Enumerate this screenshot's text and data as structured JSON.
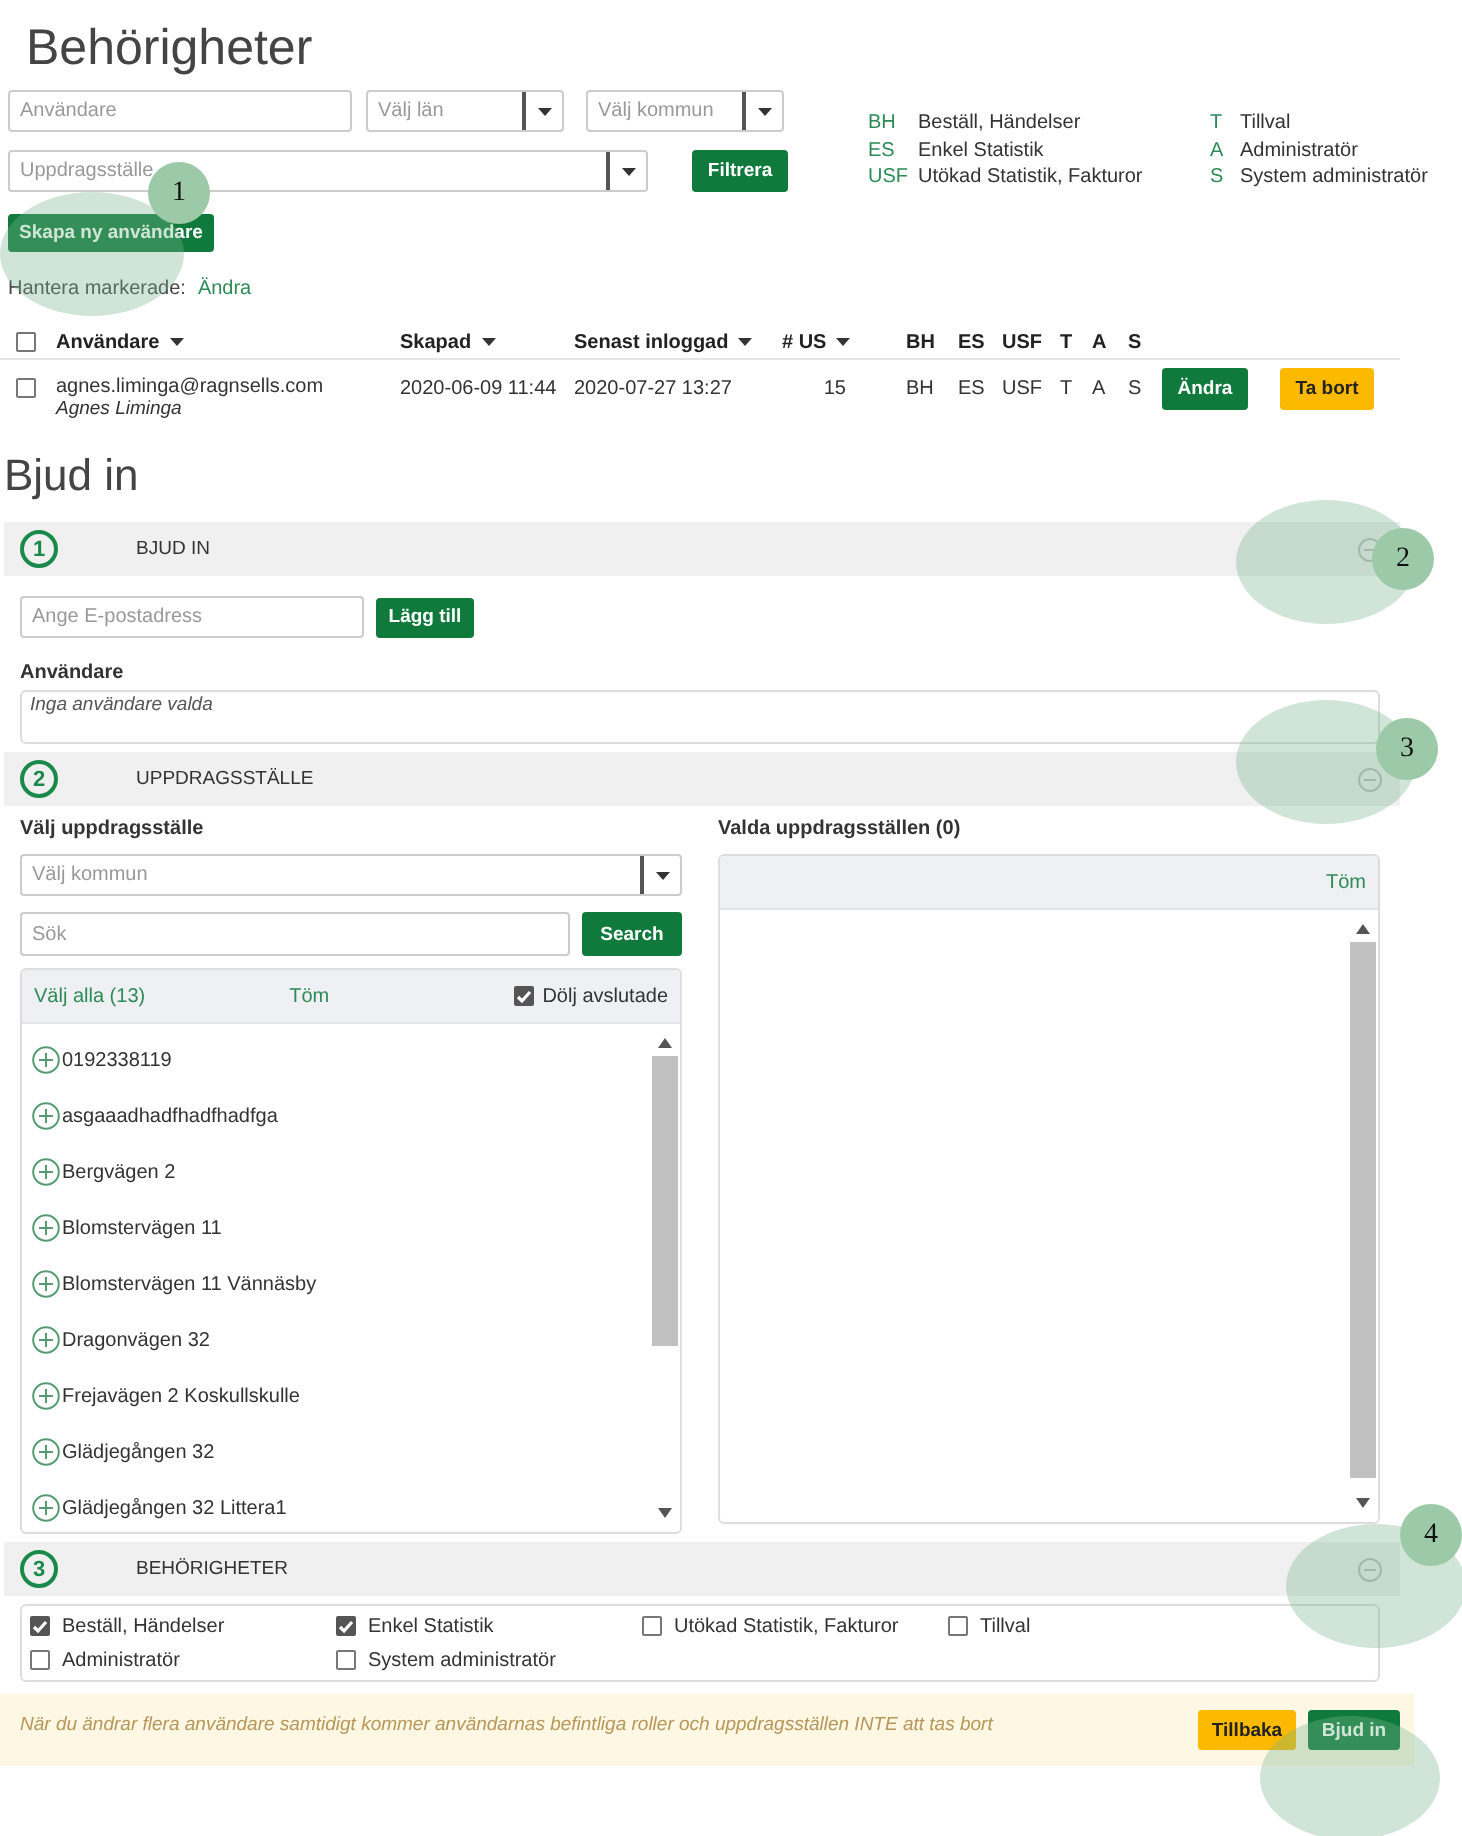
{
  "page_title": "Behörigheter",
  "filters": {
    "user": {
      "placeholder": "Användare"
    },
    "county": {
      "placeholder": "Välj län"
    },
    "municipality": {
      "placeholder": "Välj kommun"
    },
    "assignment": {
      "placeholder": "Uppdragsställe"
    },
    "filter_button": "Filtrera"
  },
  "legend": [
    {
      "code": "BH",
      "label": "Beställ, Händelser"
    },
    {
      "code": "T",
      "label": "Tillval"
    },
    {
      "code": "ES",
      "label": "Enkel Statistik"
    },
    {
      "code": "A",
      "label": "Administratör"
    },
    {
      "code": "USF",
      "label": "Utökad Statistik, Fakturor"
    },
    {
      "code": "S",
      "label": "System administratör"
    }
  ],
  "create_button": "Skapa ny användare",
  "bulk": {
    "label": "Hantera markerade:",
    "link": "Ändra"
  },
  "table": {
    "select_all_checked": false,
    "columns": [
      {
        "label": "Användare",
        "sortable": true
      },
      {
        "label": "Skapad",
        "sortable": true
      },
      {
        "label": "Senast inloggad",
        "sortable": true
      },
      {
        "label": "# US",
        "sortable": true
      },
      {
        "label": "BH",
        "sortable": false
      },
      {
        "label": "ES",
        "sortable": false
      },
      {
        "label": "USF",
        "sortable": false
      },
      {
        "label": "T",
        "sortable": false
      },
      {
        "label": "A",
        "sortable": false
      },
      {
        "label": "S",
        "sortable": false
      }
    ],
    "rows": [
      {
        "checked": false,
        "email": "agnes.liminga@ragnsells.com",
        "name": "Agnes Liminga",
        "created": "2020-06-09 11:44",
        "last_login": "2020-07-27 13:27",
        "us": "15",
        "roles": [
          "BH",
          "ES",
          "USF",
          "T",
          "A",
          "S"
        ],
        "edit": "Ändra",
        "delete": "Ta bort"
      }
    ]
  },
  "invite_title": "Bjud in",
  "sections": [
    {
      "number": "1",
      "title": "BJUD IN",
      "expanded": true
    },
    {
      "number": "2",
      "title": "UPPDRAGSSTÄLLE",
      "expanded": true
    },
    {
      "number": "3",
      "title": "BEHÖRIGHETER",
      "expanded": true
    }
  ],
  "invite": {
    "email_placeholder": "Ange E-postadress",
    "add_button": "Lägg till",
    "users_label": "Användare",
    "empty_text": "Inga användare valda"
  },
  "places": {
    "label": "Välj uppdragsställe",
    "municipality_placeholder": "Välj kommun",
    "search_placeholder": "Sök",
    "search_button": "Search",
    "select_all": "Välj alla (13)",
    "clear": "Töm",
    "hide_finished": {
      "label": "Dölj avslutade",
      "checked": true
    },
    "items": [
      "0192338119",
      "asgaaadhadfhadfhadfga",
      "Bergvägen 2",
      "Blomstervägen 11",
      "Blomstervägen 11 Vännäsby",
      "Dragonvägen 32",
      "Frejavägen 2 Koskullskulle",
      "Glädjegången 32",
      "Glädjegången 32 Littera1"
    ],
    "selected_label": "Valda uppdragsställen (0)",
    "selected_clear": "Töm"
  },
  "permissions": [
    {
      "label": "Beställ, Händelser",
      "checked": true
    },
    {
      "label": "Enkel Statistik",
      "checked": true
    },
    {
      "label": "Utökad Statistik, Fakturor",
      "checked": false
    },
    {
      "label": "Tillval",
      "checked": false
    },
    {
      "label": "Administratör",
      "checked": false
    },
    {
      "label": "System administratör",
      "checked": false
    }
  ],
  "footer": {
    "notice": "När du ändrar flera användare samtidigt kommer användarnas befintliga roller och uppdragsställen INTE att tas bort",
    "back": "Tillbaka",
    "invite": "Bjud in"
  },
  "callouts": [
    {
      "label": "1"
    },
    {
      "label": "2"
    },
    {
      "label": "3"
    },
    {
      "label": "4"
    }
  ]
}
